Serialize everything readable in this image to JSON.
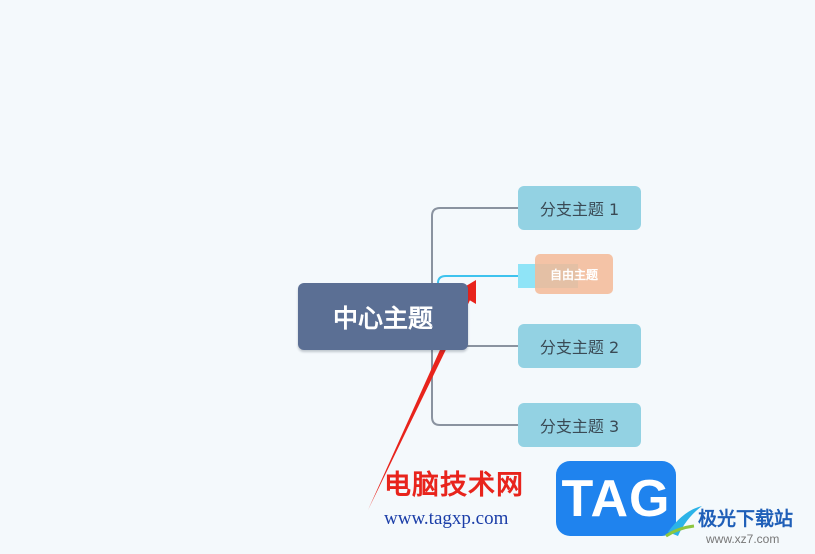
{
  "mindmap": {
    "central_topic": "中心主题",
    "branches": [
      "分支主题 1",
      "分支主题 2",
      "分支主题 3"
    ],
    "free_topic": "自由主题"
  },
  "watermark": {
    "site_name_cn": "电脑技术网",
    "site_url": "www.tagxp.com",
    "logo_text": "TAG",
    "brand_cn": "极光下载站",
    "brand_url": "www.xz7.com"
  },
  "colors": {
    "background": "#f4f9fc",
    "central_topic": "#5b6f94",
    "branch_topic": "#93d2e3",
    "free_topic": "#f3ba96",
    "connector": "#8a93a0",
    "arrow": "#e8241c"
  },
  "icons": [
    "red-arrow-annotation-icon",
    "tag-logo-icon"
  ]
}
